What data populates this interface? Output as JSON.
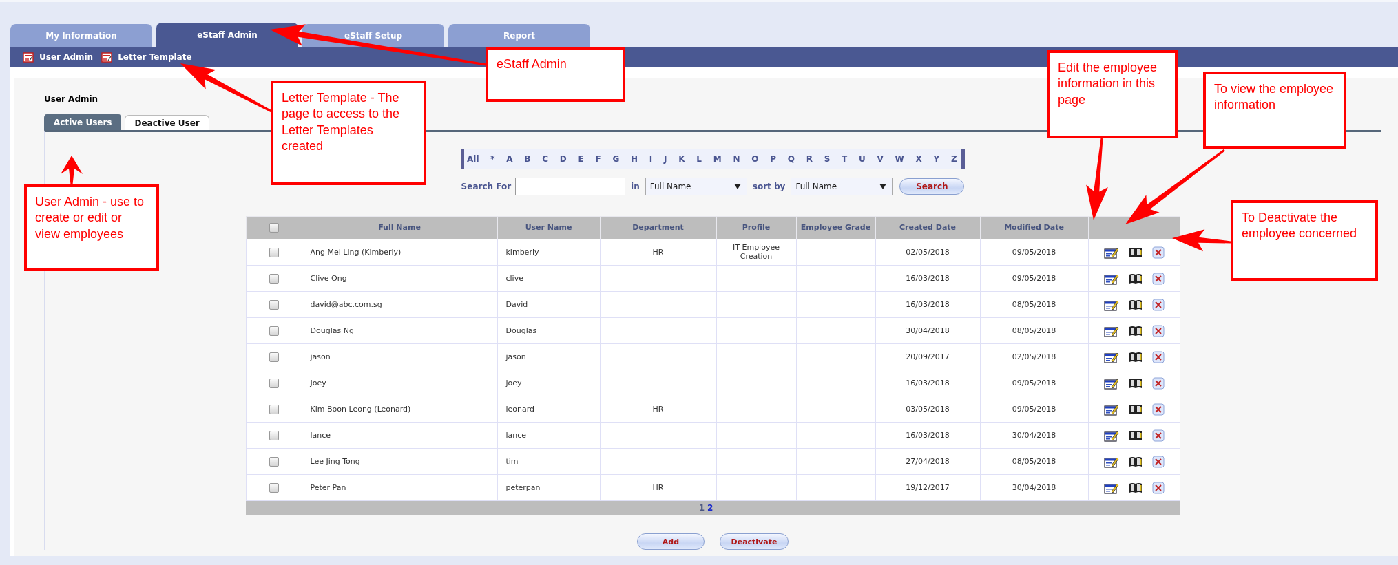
{
  "tabs": [
    {
      "label": "My Information",
      "selected": false
    },
    {
      "label": "eStaff Admin",
      "selected": true
    },
    {
      "label": "eStaff Setup",
      "selected": false
    },
    {
      "label": "Report",
      "selected": false
    }
  ],
  "subnav": [
    {
      "label": "User Admin"
    },
    {
      "label": "Letter Template"
    }
  ],
  "page_title": "User Admin",
  "subtabs": [
    {
      "label": "Active Users",
      "selected": true
    },
    {
      "label": "Deactive User",
      "selected": false
    }
  ],
  "alphabet": [
    "All",
    "*",
    "A",
    "B",
    "C",
    "D",
    "E",
    "F",
    "G",
    "H",
    "I",
    "J",
    "K",
    "L",
    "M",
    "N",
    "O",
    "P",
    "Q",
    "R",
    "S",
    "T",
    "U",
    "V",
    "W",
    "X",
    "Y",
    "Z"
  ],
  "search": {
    "label": "Search For",
    "in_label": "in",
    "field": "Full Name",
    "sort_label": "sort by",
    "sort": "Full Name",
    "button": "Search"
  },
  "table": {
    "select_all_checked": false,
    "columns": [
      "Full Name",
      "User Name",
      "Department",
      "Profile",
      "Employee Grade",
      "Created Date",
      "Modified Date"
    ],
    "rows": [
      {
        "checked": false,
        "full_name": "Ang Mei Ling (Kimberly)",
        "user_name": "kimberly",
        "department": "HR",
        "profile": "IT Employee Creation",
        "created_date": "02/05/2018",
        "modified_date": "09/05/2018"
      },
      {
        "checked": false,
        "full_name": "Clive Ong",
        "user_name": "clive",
        "created_date": "16/03/2018",
        "modified_date": "09/05/2018"
      },
      {
        "checked": false,
        "full_name": "david@abc.com.sg",
        "user_name": "David",
        "created_date": "16/03/2018",
        "modified_date": "08/05/2018"
      },
      {
        "checked": false,
        "full_name": "Douglas Ng",
        "user_name": "Douglas",
        "created_date": "30/04/2018",
        "modified_date": "08/05/2018"
      },
      {
        "checked": false,
        "full_name": "jason",
        "user_name": "jason",
        "created_date": "20/09/2017",
        "modified_date": "02/05/2018"
      },
      {
        "checked": false,
        "full_name": "Joey",
        "user_name": "joey",
        "created_date": "16/03/2018",
        "modified_date": "09/05/2018"
      },
      {
        "checked": false,
        "full_name": "Kim Boon Leong (Leonard)",
        "user_name": "leonard",
        "department": "HR",
        "created_date": "03/05/2018",
        "modified_date": "09/05/2018"
      },
      {
        "checked": false,
        "full_name": "lance",
        "user_name": "lance",
        "created_date": "16/03/2018",
        "modified_date": "30/04/2018"
      },
      {
        "checked": false,
        "full_name": "Lee Jing Tong",
        "user_name": "tim",
        "created_date": "27/04/2018",
        "modified_date": "08/05/2018"
      },
      {
        "checked": false,
        "full_name": "Peter Pan",
        "user_name": "peterpan",
        "department": "HR",
        "created_date": "19/12/2017",
        "modified_date": "30/04/2018"
      }
    ],
    "pages": [
      {
        "label": "1",
        "selected": true
      },
      {
        "label": "2",
        "selected": false
      }
    ]
  },
  "buttons": [
    {
      "label": "Add"
    },
    {
      "label": "Deactivate"
    }
  ],
  "annotations": [
    {
      "text": "eStaff Admin"
    },
    {
      "text": "Letter Template - The page to access to the Letter Templates created"
    },
    {
      "text": "User Admin - use to create or edit or view employees"
    },
    {
      "text": "Edit the employee information in this page"
    },
    {
      "text": "To view the employee information"
    },
    {
      "text": "To Deactivate the employee concerned"
    }
  ]
}
